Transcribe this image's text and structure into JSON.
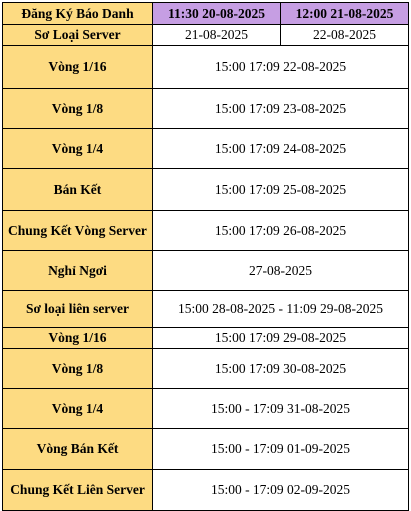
{
  "header": {
    "register_label": "Đăng Ký Báo Danh",
    "register_start": "11:30 20-08-2025",
    "register_end": "12:00 21-08-2025"
  },
  "prelim_server": {
    "label": "Sơ Loại Server",
    "date_1": "21-08-2025",
    "date_2": "22-08-2025"
  },
  "rows": [
    {
      "label": "Vòng 1/16",
      "value": "15:00  17:09 22-08-2025"
    },
    {
      "label": "Vòng 1/8",
      "value": "15:00  17:09 23-08-2025"
    },
    {
      "label": "Vòng 1/4",
      "value": "15:00 17:09 24-08-2025"
    },
    {
      "label": "Bán Kết",
      "value": "15:00 17:09 25-08-2025"
    },
    {
      "label": "Chung Kết Vòng Server",
      "value": "15:00 17:09 26-08-2025"
    },
    {
      "label": "Nghỉ Ngơi",
      "value": "27-08-2025"
    },
    {
      "label": "Sơ loại liên server",
      "value": "15:00 28-08-2025 - 11:09 29-08-2025"
    },
    {
      "label": "Vòng 1/16",
      "value": "15:00 17:09 29-08-2025"
    },
    {
      "label": "Vòng 1/8",
      "value": "15:00 17:09 30-08-2025"
    },
    {
      "label": "Vòng 1/4",
      "value": "15:00 - 17:09 31-08-2025"
    },
    {
      "label": "Vòng Bán Kết",
      "value": "15:00 - 17:09 01-09-2025"
    },
    {
      "label": "Chung Kết Liên Server",
      "value": "15:00 - 17:09 02-09-2025"
    }
  ]
}
